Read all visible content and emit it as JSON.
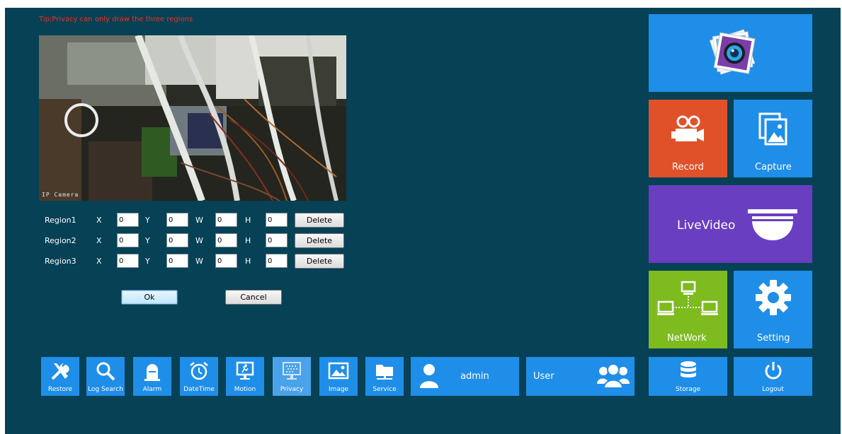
{
  "tip": "Tip:Privacy can only draw the three regions",
  "preview": {
    "osd": "IP Camera"
  },
  "regions": [
    {
      "label": "Region1",
      "x": "0",
      "y": "0",
      "w": "0",
      "h": "0"
    },
    {
      "label": "Region2",
      "x": "0",
      "y": "0",
      "w": "0",
      "h": "0"
    },
    {
      "label": "Region3",
      "x": "0",
      "y": "0",
      "w": "0",
      "h": "0"
    }
  ],
  "axes": {
    "x": "X",
    "y": "Y",
    "w": "W",
    "h": "H"
  },
  "delete_label": "Delete",
  "ok_label": "Ok",
  "cancel_label": "Cancel",
  "tiles": {
    "record": "Record",
    "capture": "Capture",
    "livevideo": "LiveVideo",
    "network": "NetWork",
    "setting": "Setting",
    "storage": "Storage",
    "logout": "Logout"
  },
  "bottom": [
    {
      "label": "Restore",
      "icon": "tools-icon"
    },
    {
      "label": "Log Search",
      "icon": "search-icon"
    },
    {
      "label": "Alarm",
      "icon": "alarm-light-icon"
    },
    {
      "label": "DateTime",
      "icon": "alarm-clock-icon"
    },
    {
      "label": "Motion",
      "icon": "motion-icon"
    },
    {
      "label": "Privacy",
      "icon": "privacy-icon"
    },
    {
      "label": "Image",
      "icon": "image-icon"
    },
    {
      "label": "Service",
      "icon": "folder-icon"
    }
  ],
  "admin_label": "admin",
  "user_label": "User",
  "colors": {
    "background": "#064155",
    "tile_blue": "#1f8ee8",
    "tile_orange": "#e0512a",
    "tile_purple": "#6a3ec0",
    "tile_green": "#7dbb1f",
    "tip_red": "#ff2a1a"
  }
}
